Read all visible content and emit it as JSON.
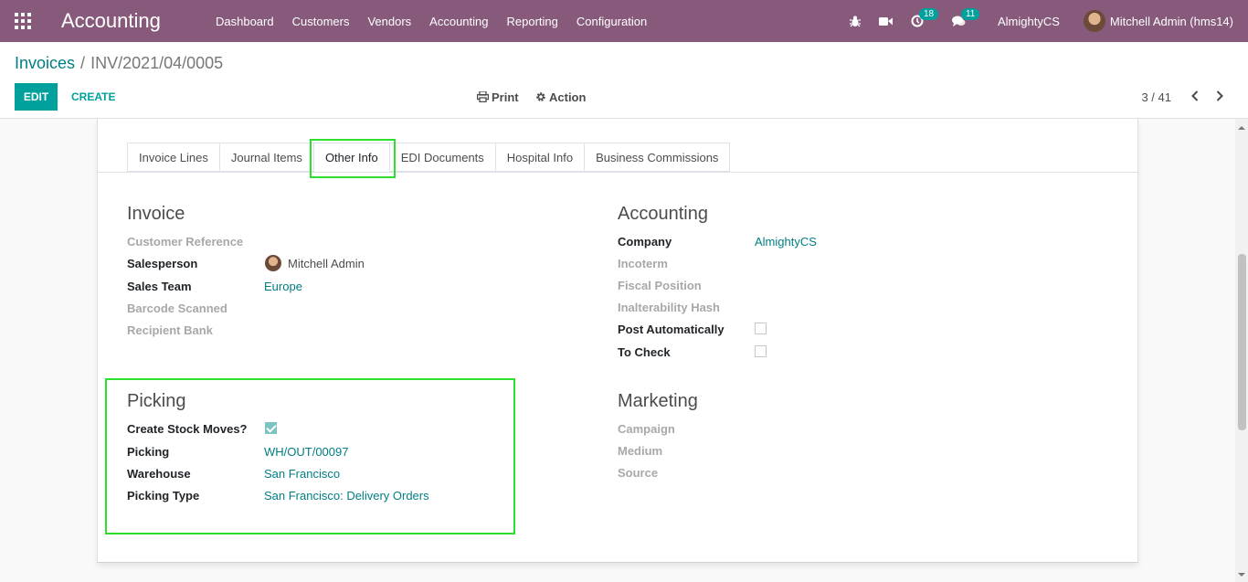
{
  "navbar": {
    "app_title": "Accounting",
    "menu": [
      "Dashboard",
      "Customers",
      "Vendors",
      "Accounting",
      "Reporting",
      "Configuration"
    ],
    "activity_count": "18",
    "message_count": "11",
    "company": "AlmightyCS",
    "user": "Mitchell Admin (hms14)"
  },
  "control": {
    "breadcrumb_parent": "Invoices",
    "breadcrumb_current": "INV/2021/04/0005",
    "edit_label": "EDIT",
    "create_label": "CREATE",
    "print_label": "Print",
    "action_label": "Action",
    "pager": "3 / 41"
  },
  "tabs": [
    "Invoice Lines",
    "Journal Items",
    "Other Info",
    "EDI Documents",
    "Hospital Info",
    "Business Commissions"
  ],
  "invoice": {
    "title": "Invoice",
    "customer_reference_label": "Customer Reference",
    "salesperson_label": "Salesperson",
    "salesperson_value": "Mitchell Admin",
    "sales_team_label": "Sales Team",
    "sales_team_value": "Europe",
    "barcode_label": "Barcode Scanned",
    "recipient_bank_label": "Recipient Bank"
  },
  "accounting": {
    "title": "Accounting",
    "company_label": "Company",
    "company_value": "AlmightyCS",
    "incoterm_label": "Incoterm",
    "fiscal_position_label": "Fiscal Position",
    "hash_label": "Inalterability Hash",
    "post_auto_label": "Post Automatically",
    "post_auto_checked": false,
    "to_check_label": "To Check",
    "to_check_checked": false
  },
  "picking": {
    "title": "Picking",
    "create_moves_label": "Create Stock Moves?",
    "create_moves_checked": true,
    "picking_label": "Picking",
    "picking_value": "WH/OUT/00097",
    "warehouse_label": "Warehouse",
    "warehouse_value": "San Francisco",
    "picking_type_label": "Picking Type",
    "picking_type_value": "San Francisco: Delivery Orders"
  },
  "marketing": {
    "title": "Marketing",
    "campaign_label": "Campaign",
    "medium_label": "Medium",
    "source_label": "Source"
  },
  "colors": {
    "brand": "#875a7b",
    "accent": "#00a09d",
    "link": "#017e84",
    "highlight": "#2de02d"
  }
}
